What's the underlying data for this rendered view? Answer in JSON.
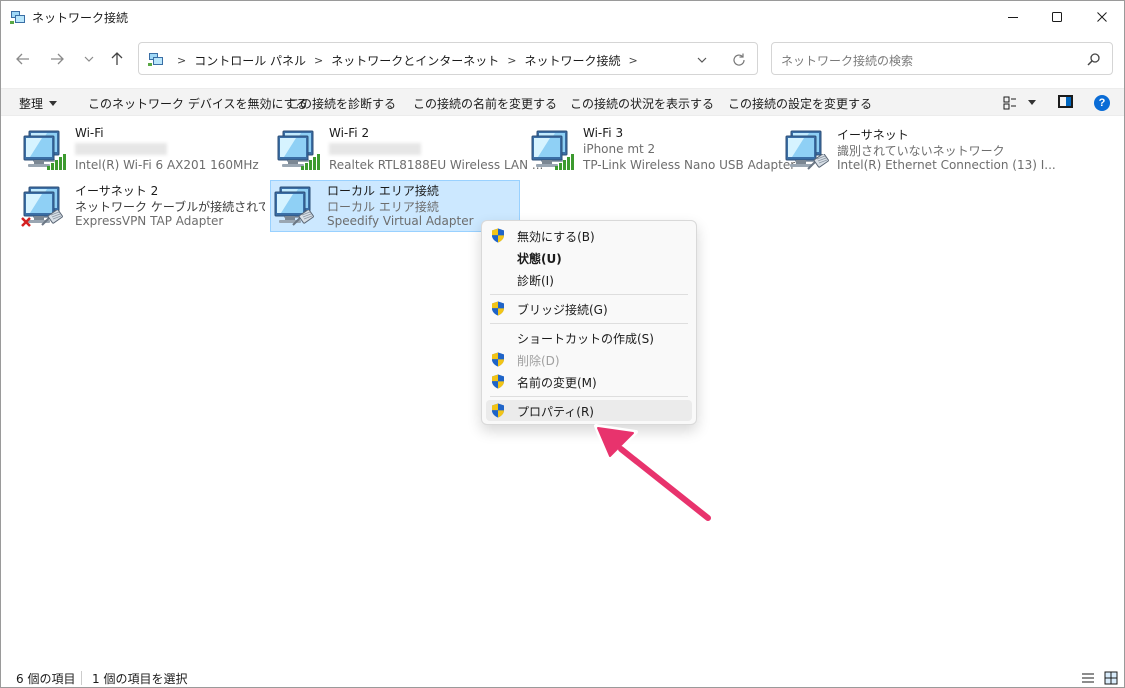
{
  "window": {
    "title": "ネットワーク接続",
    "controls": {
      "minimize": "minimize-icon",
      "maximize": "maximize-icon",
      "close": "close-icon"
    }
  },
  "address_bar": {
    "breadcrumbs": [
      "コントロール パネル",
      "ネットワークとインターネット",
      "ネットワーク接続"
    ],
    "search_placeholder": "ネットワーク接続の検索"
  },
  "command_bar": {
    "organize": "整理",
    "disable": "このネットワーク デバイスを無効にする",
    "diagnose": "この接続を診断する",
    "rename": "この接続の名前を変更する",
    "status": "この接続の状況を表示する",
    "settings": "この接続の設定を変更する"
  },
  "connections": [
    {
      "name": "Wi-Fi",
      "status": "",
      "adapter": "Intel(R) Wi-Fi 6 AX201 160MHz",
      "type": "wifi",
      "blurred": true
    },
    {
      "name": "Wi-Fi 2",
      "status": "",
      "adapter": "Realtek RTL8188EU Wireless LAN ...",
      "type": "wifi",
      "blurred": true
    },
    {
      "name": "Wi-Fi 3",
      "status": "iPhone mt 2",
      "adapter": "TP-Link Wireless Nano USB Adapter",
      "type": "wifi",
      "blurred": false
    },
    {
      "name": "イーサネット",
      "status": "識別されていないネットワーク",
      "adapter": "Intel(R) Ethernet Connection (13) I...",
      "type": "ethernet",
      "blurred": false
    },
    {
      "name": "イーサネット 2",
      "status": "ネットワーク ケーブルが接続されていま...",
      "adapter": "ExpressVPN TAP Adapter",
      "type": "ethernet-disconnected",
      "blurred": false
    },
    {
      "name": "ローカル エリア接続",
      "status": "ローカル エリア接続",
      "adapter": "Speedify Virtual Adapter",
      "type": "ethernet",
      "blurred": false,
      "selected": true
    }
  ],
  "context_menu": {
    "items": [
      {
        "label": "無効にする(B)",
        "shield": true
      },
      {
        "label": "状態(U)",
        "bold": true
      },
      {
        "label": "診断(I)"
      },
      {
        "label": "ブリッジ接続(G)",
        "shield": true
      },
      {
        "label": "ショートカットの作成(S)"
      },
      {
        "label": "削除(D)",
        "shield": true,
        "disabled": true
      },
      {
        "label": "名前の変更(M)",
        "shield": true
      },
      {
        "label": "プロパティ(R)",
        "shield": true,
        "highlighted": true
      }
    ]
  },
  "status_bar": {
    "item_count": "6 個の項目",
    "selected_count": "1 個の項目を選択"
  },
  "colors": {
    "accent": "#0067c0",
    "selection": "#cce8ff",
    "arrow": "#e8336d"
  }
}
